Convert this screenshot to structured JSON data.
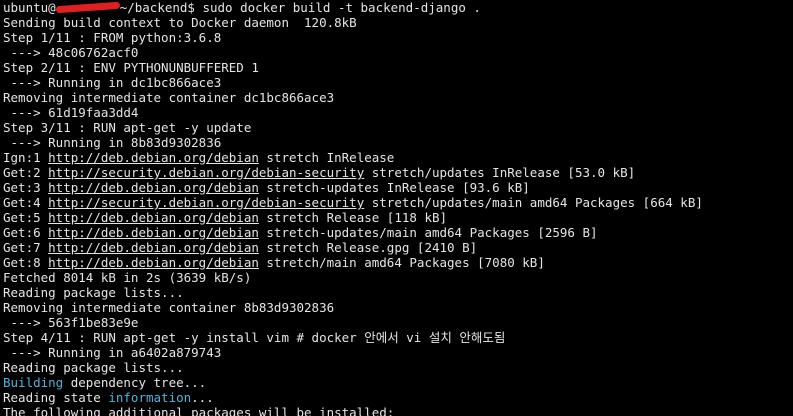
{
  "prompt": {
    "user": "ubuntu@",
    "path_suffix": "~/backend$",
    "command": " sudo docker build -t backend-django ."
  },
  "lines": [
    [
      {
        "t": "Sending build context to Docker daemon  120.8kB"
      }
    ],
    [
      {
        "t": "Step 1/11 : FROM python:3.6.8"
      }
    ],
    [
      {
        "t": " ---> 48c06762acf0"
      }
    ],
    [
      {
        "t": "Step 2/11 : ENV PYTHONUNBUFFERED 1"
      }
    ],
    [
      {
        "t": " ---> Running in dc1bc866ace3"
      }
    ],
    [
      {
        "t": "Removing intermediate container dc1bc866ace3"
      }
    ],
    [
      {
        "t": " ---> 61d19faa3dd4"
      }
    ],
    [
      {
        "t": "Step 3/11 : RUN apt-get -y update"
      }
    ],
    [
      {
        "t": " ---> Running in 8b83d9302836"
      }
    ],
    [
      {
        "t": "Ign:1 "
      },
      {
        "t": "http://deb.debian.org/debian",
        "u": true
      },
      {
        "t": " stretch InRelease"
      }
    ],
    [
      {
        "t": "Get:2 "
      },
      {
        "t": "http://security.debian.org/debian-security",
        "u": true
      },
      {
        "t": " stretch/updates InRelease [53.0 kB]"
      }
    ],
    [
      {
        "t": "Get:3 "
      },
      {
        "t": "http://deb.debian.org/debian",
        "u": true
      },
      {
        "t": " stretch-updates InRelease [93.6 kB]"
      }
    ],
    [
      {
        "t": "Get:4 "
      },
      {
        "t": "http://security.debian.org/debian-security",
        "u": true
      },
      {
        "t": " stretch/updates/main amd64 Packages [664 kB]"
      }
    ],
    [
      {
        "t": "Get:5 "
      },
      {
        "t": "http://deb.debian.org/debian",
        "u": true
      },
      {
        "t": " stretch Release [118 kB]"
      }
    ],
    [
      {
        "t": "Get:6 "
      },
      {
        "t": "http://deb.debian.org/debian",
        "u": true
      },
      {
        "t": " stretch-updates/main amd64 Packages [2596 B]"
      }
    ],
    [
      {
        "t": "Get:7 "
      },
      {
        "t": "http://deb.debian.org/debian",
        "u": true
      },
      {
        "t": " stretch Release.gpg [2410 B]"
      }
    ],
    [
      {
        "t": "Get:8 "
      },
      {
        "t": "http://deb.debian.org/debian",
        "u": true
      },
      {
        "t": " stretch/main amd64 Packages [7080 kB]"
      }
    ],
    [
      {
        "t": "Fetched 8014 kB in 2s (3639 kB/s)"
      }
    ],
    [
      {
        "t": "Reading package lists..."
      }
    ],
    [
      {
        "t": "Removing intermediate container 8b83d9302836"
      }
    ],
    [
      {
        "t": " ---> 563f1be83e9e"
      }
    ],
    [
      {
        "t": "Step 4/11 : RUN apt-get -y install vim # docker 안에서 vi 설치 안해도됨"
      }
    ],
    [
      {
        "t": " ---> Running in a6402a879743"
      }
    ],
    [
      {
        "t": "Reading package lists..."
      }
    ],
    [
      {
        "t": "Building",
        "c": "cyan"
      },
      {
        "t": " dependency tree..."
      }
    ],
    [
      {
        "t": "Reading state "
      },
      {
        "t": "information",
        "c": "cyan"
      },
      {
        "t": "..."
      }
    ],
    [
      {
        "t": "The following additional packages will be installed:"
      }
    ]
  ],
  "colors": {
    "background": "#000000",
    "foreground": "#e5e5e5",
    "highlight": "#4fb3d9",
    "redaction": "#e02020"
  }
}
